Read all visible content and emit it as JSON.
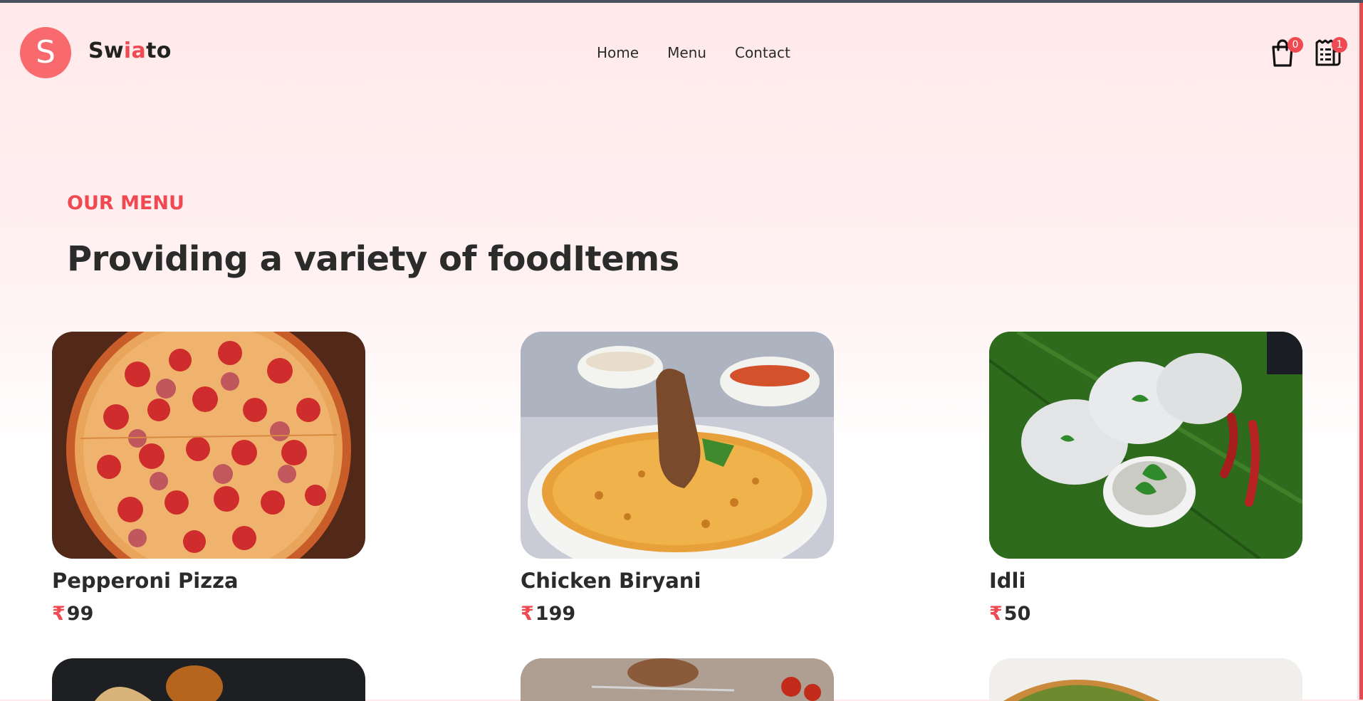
{
  "brand": {
    "logo_letter": "S",
    "name_part1": "Sw",
    "name_accent": "ia",
    "name_part2": "to"
  },
  "nav": {
    "items": [
      "Home",
      "Menu",
      "Contact"
    ]
  },
  "header_icons": {
    "cart": {
      "icon": "shopping-bag-icon",
      "count": "0"
    },
    "orders": {
      "icon": "receipt-icon",
      "count": "1"
    }
  },
  "section": {
    "kicker": "OUR MENU",
    "headline": "Providing a variety of foodItems"
  },
  "menu_items": [
    {
      "name": "Pepperoni Pizza",
      "currency": "₹",
      "price": "99"
    },
    {
      "name": "Chicken Biryani",
      "currency": "₹",
      "price": "199"
    },
    {
      "name": "Idli",
      "currency": "₹",
      "price": "50"
    }
  ],
  "colors": {
    "accent": "#ef4a52",
    "logo": "#f86a6e",
    "text": "#2b2b2b"
  }
}
